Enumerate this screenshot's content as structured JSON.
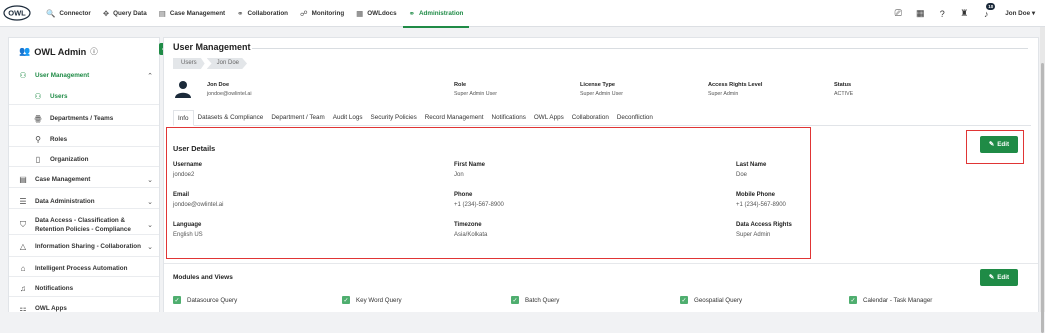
{
  "topbar": {
    "logo": {
      "text": "OWL",
      "icon": "owl-logo-icon"
    },
    "nav": [
      {
        "label": "Connector",
        "icon": "search-icon",
        "glyph": "🔍",
        "active": false
      },
      {
        "label": "Query Data",
        "icon": "query-icon",
        "glyph": "✥",
        "active": false
      },
      {
        "label": "Case Management",
        "icon": "case-icon",
        "glyph": "▤",
        "active": false
      },
      {
        "label": "Collaboration",
        "icon": "collaboration-icon",
        "glyph": "⚭",
        "active": false
      },
      {
        "label": "Monitoring",
        "icon": "monitoring-icon",
        "glyph": "☍",
        "active": false
      },
      {
        "label": "OWLdocs",
        "icon": "docs-icon",
        "glyph": "▦",
        "active": false
      },
      {
        "label": "Administration",
        "icon": "administration-icon",
        "glyph": "⚭",
        "active": true
      }
    ],
    "right": {
      "icons": [
        {
          "name": "activity-icon",
          "glyph": "⎚"
        },
        {
          "name": "calendar-icon",
          "glyph": "▦"
        },
        {
          "name": "help-icon",
          "glyph": "❓"
        },
        {
          "name": "gift-icon",
          "glyph": "♜"
        }
      ],
      "notifications": {
        "icon": "bell-icon",
        "glyph": "🔔",
        "badge": "10"
      },
      "user": "Jon Doe",
      "user_chevron": "▾"
    }
  },
  "sidebar": {
    "title": "OWL Admin",
    "title_icon": "admin-users-icon",
    "info_icon": "ⓘ",
    "collapse_glyph": "‹",
    "items": [
      {
        "label": "User Management",
        "icon": "user-management-icon",
        "glyph": "⚇",
        "chevron": "︿",
        "green": true,
        "sub": false
      },
      {
        "label": "Users",
        "icon": "users-icon",
        "glyph": "⚇",
        "green": true,
        "sub": true
      },
      {
        "label": "Departments / Teams",
        "icon": "departments-icon",
        "glyph": "ꙮ",
        "green": false,
        "sub": true
      },
      {
        "label": "Roles",
        "icon": "roles-icon",
        "glyph": "⚲",
        "green": false,
        "sub": true
      },
      {
        "label": "Organization",
        "icon": "organization-icon",
        "glyph": "▯",
        "green": false,
        "sub": true
      },
      {
        "label": "Case Management",
        "icon": "case-management-icon",
        "glyph": "▤",
        "chevron": "﹀",
        "green": false,
        "sub": false
      },
      {
        "label": "Data Administration",
        "icon": "database-icon",
        "glyph": "☰",
        "chevron": "﹀",
        "green": false,
        "sub": false
      },
      {
        "label": "Data Access - Classification &",
        "label2": "Retention Policies - Compliance",
        "icon": "shield-icon",
        "glyph": "⛉",
        "chevron": "﹀",
        "green": false,
        "sub": false
      },
      {
        "label": "Information Sharing - Collaboration",
        "icon": "sharing-icon",
        "glyph": "△",
        "chevron": "﹀",
        "green": false,
        "sub": false
      },
      {
        "label": "Intelligent Process Automation",
        "icon": "automation-icon",
        "glyph": "⌂",
        "green": false,
        "sub": false
      },
      {
        "label": "Notifications",
        "icon": "notification-icon",
        "glyph": "♫",
        "green": false,
        "sub": false
      },
      {
        "label": "OWL Apps",
        "icon": "apps-icon",
        "glyph": "⚏",
        "green": false,
        "sub": false
      }
    ]
  },
  "main": {
    "title": "User Management",
    "breadcrumbs": [
      "Users",
      "Jon Doe"
    ],
    "header": {
      "name": "Jon Doe",
      "email": "jondoe@owlintel.ai",
      "role_label": "Role",
      "role_value": "Super Admin User",
      "license_label": "License Type",
      "license_value": "Super Admin User",
      "access_label": "Access Rights Level",
      "access_value": "Super Admin",
      "status_label": "Status",
      "status_value": "ACTIVE"
    },
    "tabs": [
      "Info",
      "Datasets & Compliance",
      "Department / Team",
      "Audit Logs",
      "Security Policies",
      "Record Management",
      "Notifications",
      "OWL Apps",
      "Collaboration",
      "Deconfliction"
    ],
    "active_tab": "Info",
    "edit_label": "Edit",
    "edit_icon": "✎",
    "user_details": {
      "title": "User Details",
      "fields": [
        {
          "label": "Username",
          "value": "jondoe2"
        },
        {
          "label": "First Name",
          "value": "Jon"
        },
        {
          "label": "Last Name",
          "value": "Doe"
        },
        {
          "label": "Email",
          "value": "jondoe@owlintel.ai"
        },
        {
          "label": "Phone",
          "value": "+1 (234)-567-8900"
        },
        {
          "label": "Mobile Phone",
          "value": "+1 (234)-567-8900"
        },
        {
          "label": "Language",
          "value": "English US"
        },
        {
          "label": "Timezone",
          "value": "Asia/Kolkata"
        },
        {
          "label": "Data Access Rights",
          "value": "Super Admin"
        }
      ]
    },
    "modules": {
      "title": "Modules and Views",
      "items": [
        "Datasource Query",
        "Key Word Query",
        "Batch Query",
        "Geospatial Query",
        "Calendar - Task Manager"
      ]
    }
  },
  "colors": {
    "accent": "#1f8b46",
    "highlight": "#e03535"
  }
}
